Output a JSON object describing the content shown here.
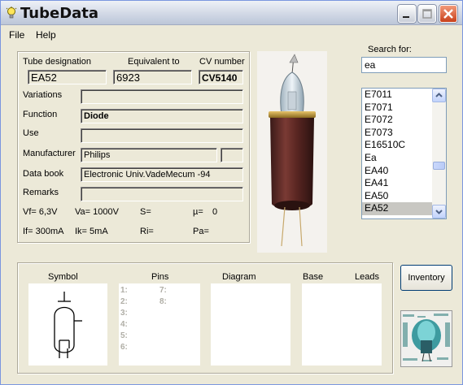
{
  "window": {
    "title": "TubeData"
  },
  "menu": {
    "file": "File",
    "help": "Help"
  },
  "form": {
    "tube_designation_label": "Tube designation",
    "tube_designation": "EA52",
    "equivalent_label": "Equivalent to",
    "equivalent": "6923",
    "cv_label": "CV number",
    "cv": "CV5140",
    "variations_label": "Variations",
    "variations": "",
    "function_label": "Function",
    "function": "Diode",
    "use_label": "Use",
    "use": "",
    "manufacturer_label": "Manufacturer",
    "manufacturer": "Philips",
    "manufacturer_extra": "",
    "databook_label": "Data book",
    "databook": "Electronic Univ.VadeMecum -94",
    "remarks_label": "Remarks",
    "remarks": ""
  },
  "params": {
    "vf": "Vf= 6,3V",
    "va": "Va= 1000V",
    "s": "S=",
    "mu": "µ=",
    "mu_value": "0",
    "if": "If= 300mA",
    "ik": "Ik=  5mA",
    "ri": "Ri=",
    "pa": "Pa="
  },
  "search": {
    "label": "Search for:",
    "value": "ea",
    "results": [
      "E7011",
      "E7071",
      "E7072",
      "E7073",
      "E16510C",
      "Ea",
      "EA40",
      "EA41",
      "EA50",
      "EA52"
    ],
    "selected": "EA52"
  },
  "bottom": {
    "symbol_label": "Symbol",
    "pins_label": "Pins",
    "diagram_label": "Diagram",
    "base_label": "Base",
    "leads_label": "Leads",
    "pins_left": [
      "1:",
      "2:",
      "3:",
      "4:",
      "5:",
      "6:"
    ],
    "pins_right": [
      "7:",
      "8:"
    ]
  },
  "buttons": {
    "inventory": "Inventory"
  }
}
